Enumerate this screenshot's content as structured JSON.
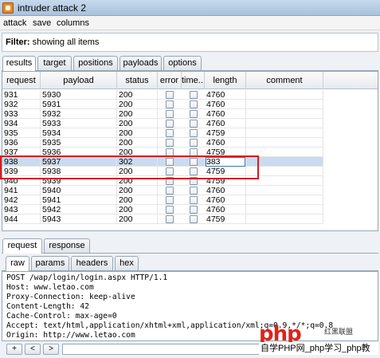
{
  "window": {
    "title": "intruder attack 2"
  },
  "menu": [
    "attack",
    "save",
    "columns"
  ],
  "filter": {
    "label": "Filter:",
    "text": "showing all items"
  },
  "main_tabs": [
    "results",
    "target",
    "positions",
    "payloads",
    "options"
  ],
  "columns": [
    "request",
    "payload",
    "status",
    "error",
    "time...",
    "length",
    "comment"
  ],
  "rows": [
    {
      "request": "931",
      "payload": "5930",
      "status": "200",
      "length": "4760"
    },
    {
      "request": "932",
      "payload": "5931",
      "status": "200",
      "length": "4760"
    },
    {
      "request": "933",
      "payload": "5932",
      "status": "200",
      "length": "4760"
    },
    {
      "request": "934",
      "payload": "5933",
      "status": "200",
      "length": "4760"
    },
    {
      "request": "935",
      "payload": "5934",
      "status": "200",
      "length": "4759"
    },
    {
      "request": "936",
      "payload": "5935",
      "status": "200",
      "length": "4760"
    },
    {
      "request": "937",
      "payload": "5936",
      "status": "200",
      "length": "4759"
    },
    {
      "request": "938",
      "payload": "5937",
      "status": "302",
      "length": "383"
    },
    {
      "request": "939",
      "payload": "5938",
      "status": "200",
      "length": "4759"
    },
    {
      "request": "940",
      "payload": "5939",
      "status": "200",
      "length": "4759"
    },
    {
      "request": "941",
      "payload": "5940",
      "status": "200",
      "length": "4760"
    },
    {
      "request": "942",
      "payload": "5941",
      "status": "200",
      "length": "4760"
    },
    {
      "request": "943",
      "payload": "5942",
      "status": "200",
      "length": "4760"
    },
    {
      "request": "944",
      "payload": "5943",
      "status": "200",
      "length": "4759"
    }
  ],
  "detail_tabs": [
    "request",
    "response"
  ],
  "view_tabs": [
    "raw",
    "params",
    "headers",
    "hex"
  ],
  "raw_request": [
    "POST /wap/login/login.aspx HTTP/1.1",
    "Host: www.letao.com",
    "Proxy-Connection: keep-alive",
    "Content-Length: 42",
    "Cache-Control: max-age=0",
    "Accept: text/html,application/xhtml+xml,application/xml;q=0.9,*/*;q=0.8",
    "Origin: http://www.letao.com"
  ],
  "toolbar_buttons": [
    "+",
    "<",
    ">"
  ],
  "watermark": {
    "logo": "php",
    "side": "红黑联盟",
    "footer": "自学PHP网_php学习_php教"
  }
}
